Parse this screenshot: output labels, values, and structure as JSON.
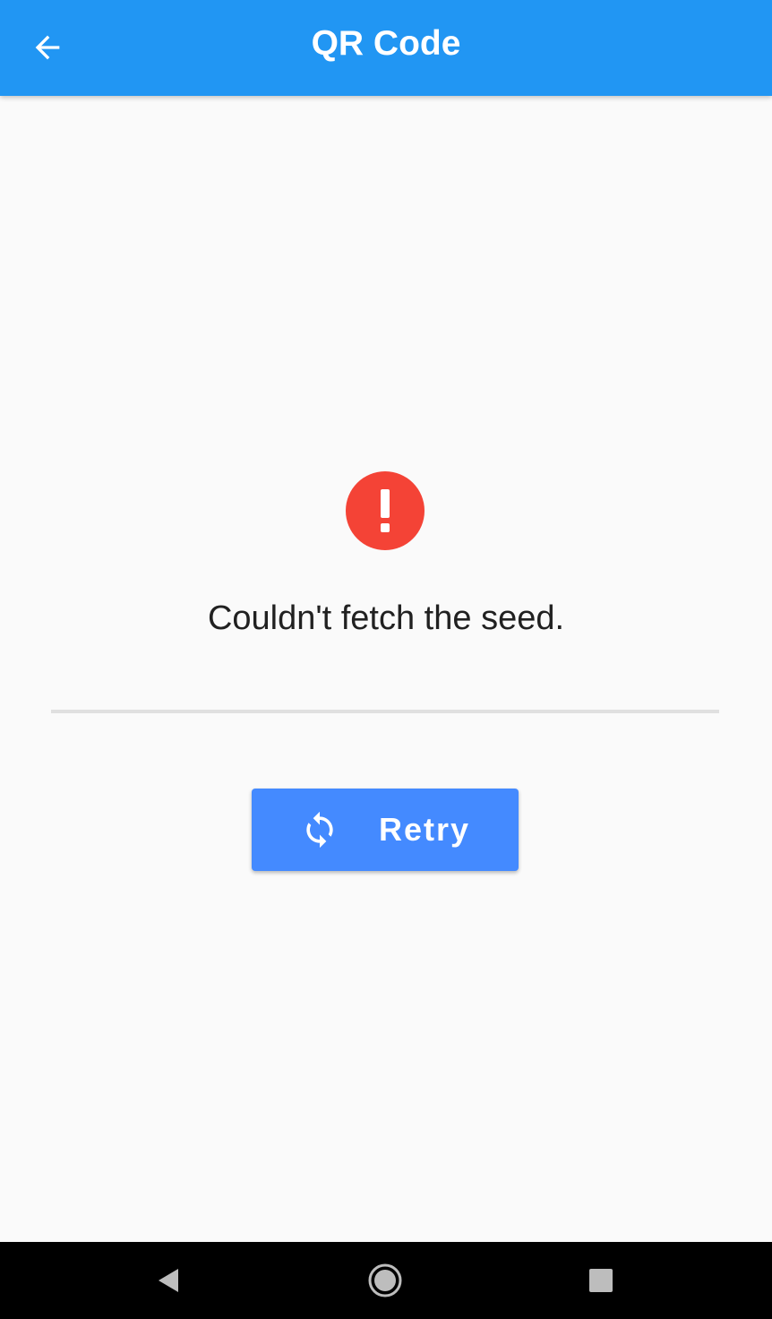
{
  "app_bar": {
    "title": "QR Code",
    "back_icon": "arrow-left-icon",
    "background_color": "#2196f3"
  },
  "error": {
    "icon": "exclamation-circle-icon",
    "icon_color": "#f44336",
    "message": "Couldn't fetch the seed."
  },
  "retry_button": {
    "label": "Retry",
    "icon": "refresh-icon",
    "background_color": "#448aff"
  },
  "system_nav": {
    "back_icon": "triangle-back-icon",
    "home_icon": "circle-home-icon",
    "recents_icon": "square-recents-icon"
  }
}
